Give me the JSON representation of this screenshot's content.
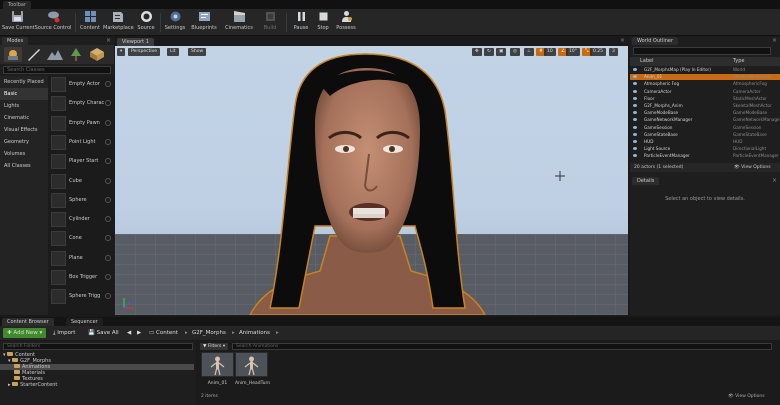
{
  "top_tab": "Toolbar",
  "toolbar": {
    "buttons": [
      {
        "label": "Save Current",
        "icon": "save-icon"
      },
      {
        "label": "Source Control",
        "icon": "source-control-icon"
      },
      {
        "label": "Content",
        "icon": "content-icon"
      },
      {
        "label": "Marketplace",
        "icon": "marketplace-icon"
      },
      {
        "label": "Source",
        "icon": "source-icon"
      },
      {
        "label": "Settings",
        "icon": "settings-icon"
      },
      {
        "label": "Blueprints",
        "icon": "blueprints-icon"
      },
      {
        "label": "Cinematics",
        "icon": "cinematics-icon"
      },
      {
        "label": "Build",
        "icon": "build-icon"
      },
      {
        "label": "Pause",
        "icon": "pause-icon"
      },
      {
        "label": "Stop",
        "icon": "stop-icon"
      },
      {
        "label": "Possess",
        "icon": "possess-icon"
      }
    ]
  },
  "modes": {
    "tab": "Modes",
    "search_placeholder": "Search Classes",
    "categories": [
      "Recently Placed",
      "Basic",
      "Lights",
      "Cinematic",
      "Visual Effects",
      "Geometry",
      "Volumes",
      "All Classes"
    ],
    "selected_category": 1,
    "actors": [
      "Empty Actor",
      "Empty Charac",
      "Empty Pawn",
      "Point Light",
      "Player Start",
      "Cube",
      "Sphere",
      "Cylinder",
      "Cone",
      "Plane",
      "Box Trigger",
      "Sphere Trigg"
    ]
  },
  "viewport": {
    "tab": "Viewport 1",
    "perspective": "Perspective",
    "lit": "Lit",
    "show": "Show",
    "grid_snap": "10",
    "rot_snap": "10°",
    "scale_snap": "0.25",
    "camera_speed": "3"
  },
  "outliner": {
    "tab": "World Outliner",
    "col_label": "Label",
    "col_type": "Type",
    "rows": [
      {
        "label": "G2F_MorphsMap (Play In Editor)",
        "type": "World"
      },
      {
        "label": "Anim_01",
        "type": "SkeletalMeshActor"
      },
      {
        "label": "Atmospheric Fog",
        "type": "AtmosphericFog"
      },
      {
        "label": "CameraActor",
        "type": "CameraActor"
      },
      {
        "label": "Floor",
        "type": "StaticMeshActor"
      },
      {
        "label": "G2F_Morphs_Anim",
        "type": "SkeletalMeshActor"
      },
      {
        "label": "GameModeBase",
        "type": "GameModeBase"
      },
      {
        "label": "GameNetworkManager",
        "type": "GameNetworkManager"
      },
      {
        "label": "GameSession",
        "type": "GameSession"
      },
      {
        "label": "GameStateBase",
        "type": "GameStateBase"
      },
      {
        "label": "HUD",
        "type": "HUD"
      },
      {
        "label": "Light Source",
        "type": "DirectionalLight"
      },
      {
        "label": "ParticleEventManager",
        "type": "ParticleEventManager"
      }
    ],
    "status": "20 actors (1 selected)",
    "view_options": "View Options"
  },
  "details": {
    "tab": "Details",
    "empty_text": "Select an object to view details."
  },
  "content_browser": {
    "tabs": [
      "Content Browser",
      "Sequencer"
    ],
    "add_new": "Add New",
    "import": "Import",
    "save_all": "Save All",
    "path": [
      "Content",
      "G2F_Morphs",
      "Animations"
    ],
    "folder_search": "Search Folders",
    "tree": [
      "Content",
      "G2F_Morphs",
      "Animations",
      "Materials",
      "Textures",
      "StarterContent"
    ],
    "filters": "Filters",
    "asset_search": "Search Animations",
    "assets": [
      "Anim_01",
      "Anim_HeadTurn"
    ],
    "items_count": "2 items",
    "view_options": "View Options"
  },
  "colors": {
    "accent_orange": "#c96b12",
    "add_new_green": "#3f8a2a",
    "selection_blue": "#4a6c8d"
  }
}
